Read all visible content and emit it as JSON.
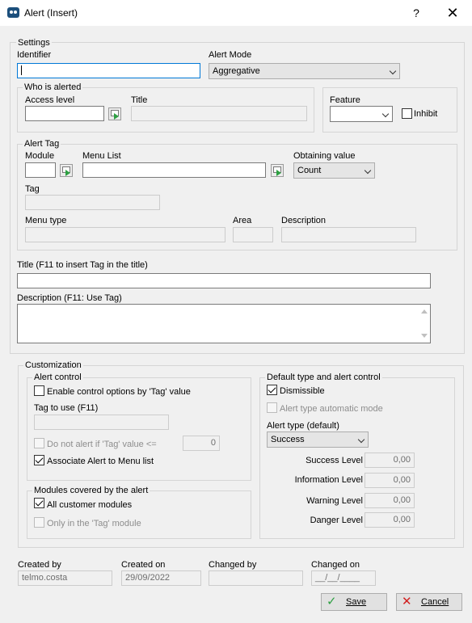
{
  "window": {
    "title": "Alert (Insert)",
    "help": "?",
    "close": "✕"
  },
  "settings": {
    "legend": "Settings",
    "identifier_label": "Identifier",
    "identifier_value": "",
    "alert_mode_label": "Alert Mode",
    "alert_mode_value": "Aggregative",
    "who": {
      "legend": "Who is alerted",
      "access_level_label": "Access level",
      "title_label": "Title"
    },
    "feature": {
      "label": "Feature",
      "value": "",
      "inhibit_label": "Inhibit"
    },
    "alert_tag": {
      "legend": "Alert Tag",
      "module_label": "Module",
      "menu_list_label": "Menu List",
      "obtaining_label": "Obtaining value",
      "obtaining_value": "Count",
      "tag_label": "Tag",
      "menu_type_label": "Menu type",
      "area_label": "Area",
      "description_label": "Description"
    },
    "title_field_label": "Title (F11 to insert Tag in the title)",
    "description_field_label": "Description (F11: Use Tag)"
  },
  "customization": {
    "legend": "Customization",
    "alert_control": {
      "legend": "Alert control",
      "enable_label": "Enable control options by 'Tag' value",
      "tag_to_use_label": "Tag to use (F11)",
      "do_not_alert_label": "Do not alert if 'Tag' value <=",
      "do_not_alert_value": "0",
      "associate_label": "Associate Alert to Menu list"
    },
    "modules": {
      "legend": "Modules covered by the alert",
      "all_label": "All customer modules",
      "only_label": "Only in the 'Tag' module"
    },
    "default_type": {
      "legend": "Default type and alert control",
      "dismissible_label": "Dismissible",
      "auto_mode_label": "Alert type automatic mode",
      "alert_type_label": "Alert type (default)",
      "alert_type_value": "Success",
      "success_label": "Success Level",
      "success_value": "0,00",
      "info_label": "Information Level",
      "info_value": "0,00",
      "warning_label": "Warning Level",
      "warning_value": "0,00",
      "danger_label": "Danger Level",
      "danger_value": "0,00"
    }
  },
  "footer": {
    "created_by_label": "Created by",
    "created_by_value": "telmo.costa",
    "created_on_label": "Created on",
    "created_on_value": "29/09/2022",
    "changed_by_label": "Changed by",
    "changed_by_value": "",
    "changed_on_label": "Changed on",
    "changed_on_value": "__/__/____",
    "save_label": "Save",
    "cancel_label": "Cancel"
  },
  "colors": {
    "accent": "#0078d7",
    "save_icon": "#2ea043",
    "cancel_icon": "#d11f1f"
  }
}
